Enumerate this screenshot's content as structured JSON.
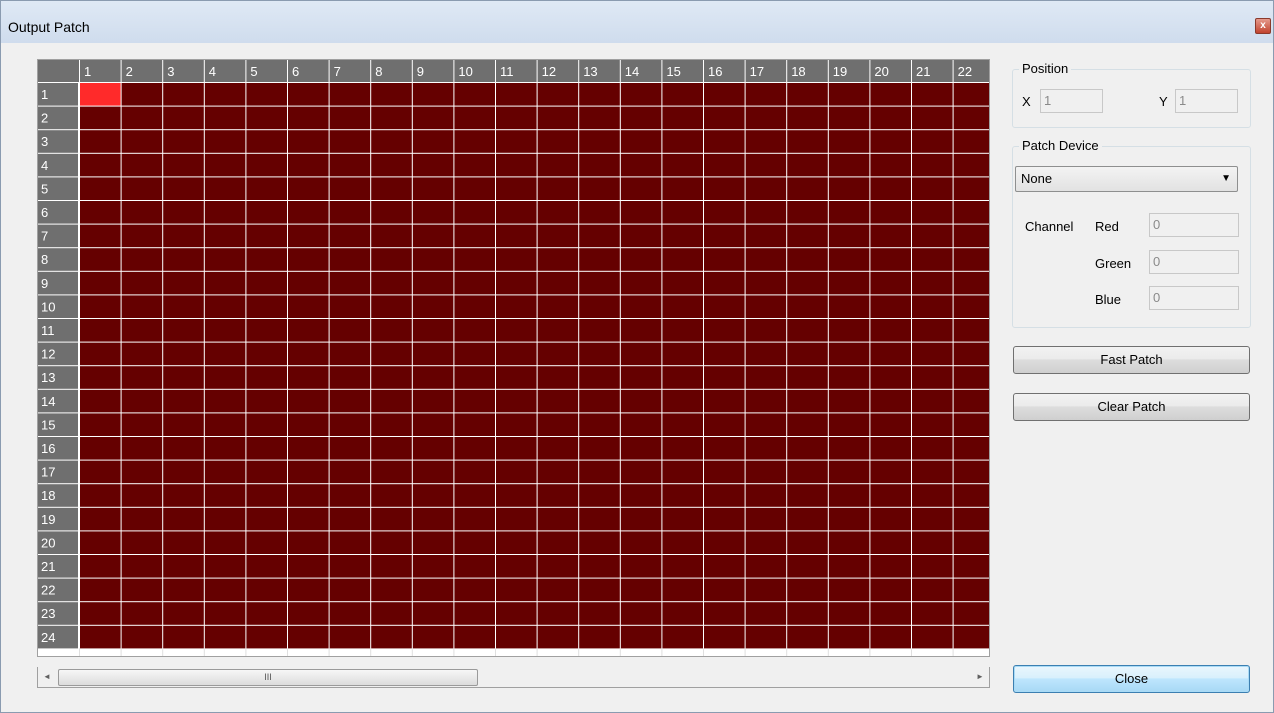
{
  "window": {
    "title": "Output Patch",
    "close_glyph": "x"
  },
  "grid": {
    "columns": [
      "1",
      "2",
      "3",
      "4",
      "5",
      "6",
      "7",
      "8",
      "9",
      "10",
      "11",
      "12",
      "13",
      "14",
      "15",
      "16",
      "17",
      "18",
      "19",
      "20",
      "21",
      "22"
    ],
    "rows": [
      "1",
      "2",
      "3",
      "4",
      "5",
      "6",
      "7",
      "8",
      "9",
      "10",
      "11",
      "12",
      "13",
      "14",
      "15",
      "16",
      "17",
      "18",
      "19",
      "20",
      "21",
      "22",
      "23",
      "24"
    ],
    "selected_cell": {
      "row": "1",
      "col": "1"
    },
    "colors": {
      "cell": "#650000",
      "selected": "#ff2a2a",
      "header": "#6f6f6f",
      "line": "#ffffff"
    }
  },
  "scrollbar": {
    "left_arrow": "◄",
    "right_arrow": "►",
    "thumb_grip": "III"
  },
  "position": {
    "legend": "Position",
    "x_label": "X",
    "x_value": "1",
    "y_label": "Y",
    "y_value": "1"
  },
  "patch_device": {
    "legend": "Patch Device",
    "selected": "None",
    "channel_label": "Channel",
    "red_label": "Red",
    "red_value": "0",
    "green_label": "Green",
    "green_value": "0",
    "blue_label": "Blue",
    "blue_value": "0"
  },
  "buttons": {
    "fast_patch": "Fast Patch",
    "clear_patch": "Clear Patch",
    "close": "Close"
  }
}
